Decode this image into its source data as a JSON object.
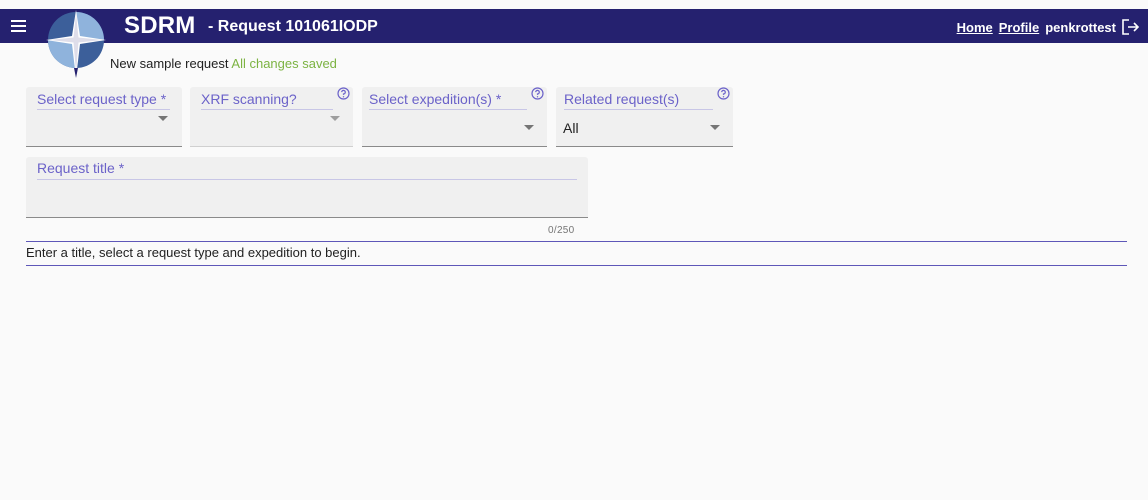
{
  "header": {
    "app_name": "SDRM",
    "request_title": "- Request 101061IODP",
    "nav": {
      "home": "Home",
      "profile": "Profile",
      "user": "penkrottest"
    }
  },
  "status": {
    "label": "New sample request",
    "save_state": "All changes saved"
  },
  "filters": {
    "request_type": {
      "label": "Select request type *",
      "value": ""
    },
    "xrf": {
      "label": "XRF scanning?",
      "value": ""
    },
    "expeditions": {
      "label": "Select expedition(s) *",
      "value": ""
    },
    "related": {
      "label": "Related request(s)",
      "value": "All"
    }
  },
  "title_input": {
    "label": "Request title *",
    "value": "",
    "counter": "0/250"
  },
  "hint": "Enter a title, select a request type and expedition to begin.",
  "colors": {
    "header_bg": "#25216f",
    "accent": "#6b62c9",
    "saved": "#7cb342"
  },
  "icons": {
    "menu": "menu-icon",
    "logo": "compass-logo",
    "help": "help-icon",
    "logout": "logout-icon",
    "dropdown": "chevron-down-icon"
  }
}
